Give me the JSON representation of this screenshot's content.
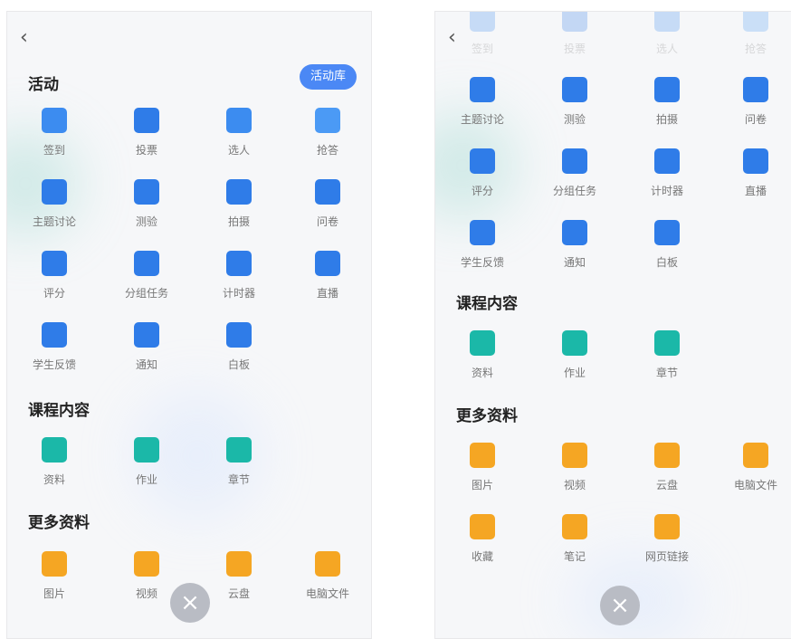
{
  "left": {
    "back_glyph": "‹",
    "activity_title": "活动",
    "activity_library": "活动库",
    "activities": [
      {
        "label": "签到",
        "icon": "hand-tap-icon",
        "color": "#3c8cf0"
      },
      {
        "label": "投票",
        "icon": "bar-chart-icon",
        "color": "#2f7ce8"
      },
      {
        "label": "选人",
        "icon": "person-select-icon",
        "color": "#3c8cf0"
      },
      {
        "label": "抢答",
        "icon": "microphone-icon",
        "color": "#4b9af5"
      },
      {
        "label": "主题讨论",
        "icon": "chat-bubble-icon",
        "color": "#2f7ce8"
      },
      {
        "label": "测验",
        "icon": "quiz-document-icon",
        "color": "#2f7ce8"
      },
      {
        "label": "拍摄",
        "icon": "camera-icon",
        "color": "#2f7ce8"
      },
      {
        "label": "问卷",
        "icon": "questionnaire-icon",
        "color": "#2f7ce8"
      },
      {
        "label": "评分",
        "icon": "flower-rating-icon",
        "color": "#2f7ce8"
      },
      {
        "label": "分组任务",
        "icon": "clipboard-check-icon",
        "color": "#2f7ce8"
      },
      {
        "label": "计时器",
        "icon": "stopwatch-icon",
        "color": "#2f7ce8"
      },
      {
        "label": "直播",
        "icon": "play-circle-icon",
        "color": "#2f7ce8"
      },
      {
        "label": "学生反馈",
        "icon": "feedback-bubble-icon",
        "color": "#2f7ce8"
      },
      {
        "label": "通知",
        "icon": "speaker-icon",
        "color": "#2f7ce8"
      },
      {
        "label": "白板",
        "icon": "whiteboard-icon",
        "color": "#2f7ce8"
      }
    ],
    "course_title": "课程内容",
    "course": [
      {
        "label": "资料",
        "icon": "folder-icon",
        "color": "#1bb8a8"
      },
      {
        "label": "作业",
        "icon": "edit-document-icon",
        "color": "#1bb8a8"
      },
      {
        "label": "章节",
        "icon": "chapter-list-icon",
        "color": "#1bb8a8"
      }
    ],
    "more_title": "更多资料",
    "more": [
      {
        "label": "图片",
        "icon": "image-icon",
        "color": "#f5a623"
      },
      {
        "label": "视频",
        "icon": "video-icon",
        "color": "#f5a623"
      },
      {
        "label": "云盘",
        "icon": "cloud-icon",
        "color": "#f5a623"
      },
      {
        "label": "电脑文件",
        "icon": "monitor-icon",
        "color": "#f5a623"
      }
    ],
    "close_glyph": "×"
  },
  "right": {
    "back_glyph": "‹",
    "top_faded": [
      {
        "label": "签到",
        "icon": "hand-tap-icon",
        "color": "#3c8cf0"
      },
      {
        "label": "投票",
        "icon": "bar-chart-icon",
        "color": "#2f7ce8"
      },
      {
        "label": "选人",
        "icon": "person-select-icon",
        "color": "#3c8cf0"
      },
      {
        "label": "抢答",
        "icon": "microphone-icon",
        "color": "#4b9af5"
      }
    ],
    "activities": [
      {
        "label": "主题讨论",
        "icon": "chat-bubble-icon",
        "color": "#2f7ce8"
      },
      {
        "label": "测验",
        "icon": "quiz-document-icon",
        "color": "#2f7ce8"
      },
      {
        "label": "拍摄",
        "icon": "camera-icon",
        "color": "#2f7ce8"
      },
      {
        "label": "问卷",
        "icon": "questionnaire-icon",
        "color": "#2f7ce8"
      },
      {
        "label": "评分",
        "icon": "flower-rating-icon",
        "color": "#2f7ce8"
      },
      {
        "label": "分组任务",
        "icon": "clipboard-check-icon",
        "color": "#2f7ce8"
      },
      {
        "label": "计时器",
        "icon": "stopwatch-icon",
        "color": "#2f7ce8"
      },
      {
        "label": "直播",
        "icon": "play-circle-icon",
        "color": "#2f7ce8"
      },
      {
        "label": "学生反馈",
        "icon": "feedback-bubble-icon",
        "color": "#2f7ce8"
      },
      {
        "label": "通知",
        "icon": "speaker-icon",
        "color": "#2f7ce8"
      },
      {
        "label": "白板",
        "icon": "whiteboard-icon",
        "color": "#2f7ce8"
      }
    ],
    "course_title": "课程内容",
    "course": [
      {
        "label": "资料",
        "icon": "folder-icon",
        "color": "#1bb8a8"
      },
      {
        "label": "作业",
        "icon": "edit-document-icon",
        "color": "#1bb8a8"
      },
      {
        "label": "章节",
        "icon": "chapter-list-icon",
        "color": "#1bb8a8"
      }
    ],
    "more_title": "更多资料",
    "more": [
      {
        "label": "图片",
        "icon": "image-icon",
        "color": "#f5a623"
      },
      {
        "label": "视频",
        "icon": "video-icon",
        "color": "#f5a623"
      },
      {
        "label": "云盘",
        "icon": "cloud-icon",
        "color": "#f5a623"
      },
      {
        "label": "电脑文件",
        "icon": "monitor-icon",
        "color": "#f5a623"
      },
      {
        "label": "收藏",
        "icon": "collection-stack-icon",
        "color": "#f5a623"
      },
      {
        "label": "笔记",
        "icon": "note-icon",
        "color": "#f5a623"
      },
      {
        "label": "网页链接",
        "icon": "link-icon",
        "color": "#f5a623"
      }
    ],
    "close_glyph": "×"
  }
}
